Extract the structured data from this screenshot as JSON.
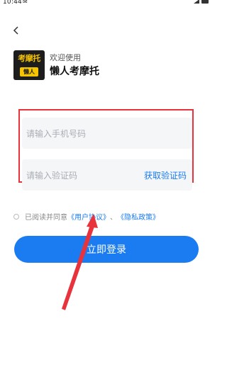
{
  "status_bar": {
    "time": "10:44",
    "app_icon": "notification-icon"
  },
  "header": {
    "back_icon": "chevron-left-icon",
    "welcome": "欢迎使用",
    "app_name": "懒人考摩托"
  },
  "logo": {
    "top_text": "考摩托",
    "bottom_text": "懒人"
  },
  "form": {
    "phone_placeholder": "请输入手机号码",
    "code_placeholder": "请输入验证码",
    "get_code_label": "获取验证码"
  },
  "agreement": {
    "prefix": "已阅读并同意",
    "user_agreement": "《用户协议》",
    "separator": "、",
    "privacy_policy": "《隐私政策》"
  },
  "login_button": "立即登录",
  "colors": {
    "accent": "#1a7cf0",
    "highlight": "#e8333d",
    "logo_bg": "#1d1d1d",
    "logo_yellow": "#f6c400"
  }
}
